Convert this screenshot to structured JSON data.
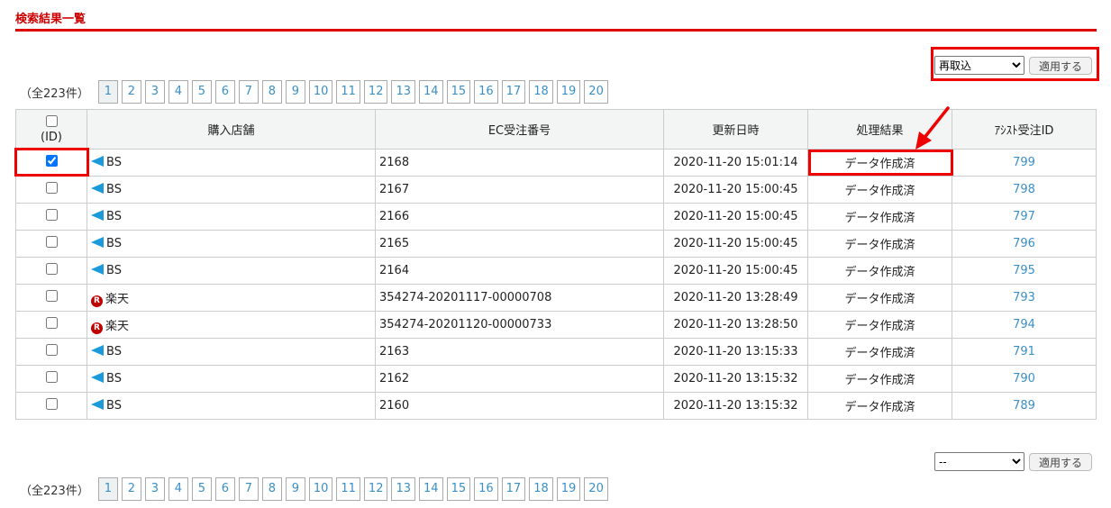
{
  "title": "検索結果一覧",
  "top_actions": {
    "selected": "再取込",
    "apply": "適用する"
  },
  "bottom_actions": {
    "selected": "--",
    "apply": "適用する"
  },
  "pager": {
    "count": "（全223件）",
    "pages": [
      "1",
      "2",
      "3",
      "4",
      "5",
      "6",
      "7",
      "8",
      "9",
      "10",
      "11",
      "12",
      "13",
      "14",
      "15",
      "16",
      "17",
      "18",
      "19",
      "20"
    ],
    "current": "1"
  },
  "columns": {
    "id": "(ID)",
    "shop": "購入店舗",
    "ec": "EC受注番号",
    "updated": "更新日時",
    "result": "処理結果",
    "assist": "ｱｼｽﾄ受注ID"
  },
  "rows": [
    {
      "checked": true,
      "shop": "BS",
      "icon": "bs",
      "ec": "2168",
      "updated": "2020-11-20 15:01:14",
      "result": "データ作成済",
      "assist": "799"
    },
    {
      "checked": false,
      "shop": "BS",
      "icon": "bs",
      "ec": "2167",
      "updated": "2020-11-20 15:00:45",
      "result": "データ作成済",
      "assist": "798"
    },
    {
      "checked": false,
      "shop": "BS",
      "icon": "bs",
      "ec": "2166",
      "updated": "2020-11-20 15:00:45",
      "result": "データ作成済",
      "assist": "797"
    },
    {
      "checked": false,
      "shop": "BS",
      "icon": "bs",
      "ec": "2165",
      "updated": "2020-11-20 15:00:45",
      "result": "データ作成済",
      "assist": "796"
    },
    {
      "checked": false,
      "shop": "BS",
      "icon": "bs",
      "ec": "2164",
      "updated": "2020-11-20 15:00:45",
      "result": "データ作成済",
      "assist": "795"
    },
    {
      "checked": false,
      "shop": "楽天",
      "icon": "rakuten",
      "ec": "354274-20201117-00000708",
      "updated": "2020-11-20 13:28:49",
      "result": "データ作成済",
      "assist": "793"
    },
    {
      "checked": false,
      "shop": "楽天",
      "icon": "rakuten",
      "ec": "354274-20201120-00000733",
      "updated": "2020-11-20 13:28:50",
      "result": "データ作成済",
      "assist": "794"
    },
    {
      "checked": false,
      "shop": "BS",
      "icon": "bs",
      "ec": "2163",
      "updated": "2020-11-20 13:15:33",
      "result": "データ作成済",
      "assist": "791"
    },
    {
      "checked": false,
      "shop": "BS",
      "icon": "bs",
      "ec": "2162",
      "updated": "2020-11-20 13:15:32",
      "result": "データ作成済",
      "assist": "790"
    },
    {
      "checked": false,
      "shop": "BS",
      "icon": "bs",
      "ec": "2160",
      "updated": "2020-11-20 13:15:32",
      "result": "データ作成済",
      "assist": "789"
    }
  ]
}
